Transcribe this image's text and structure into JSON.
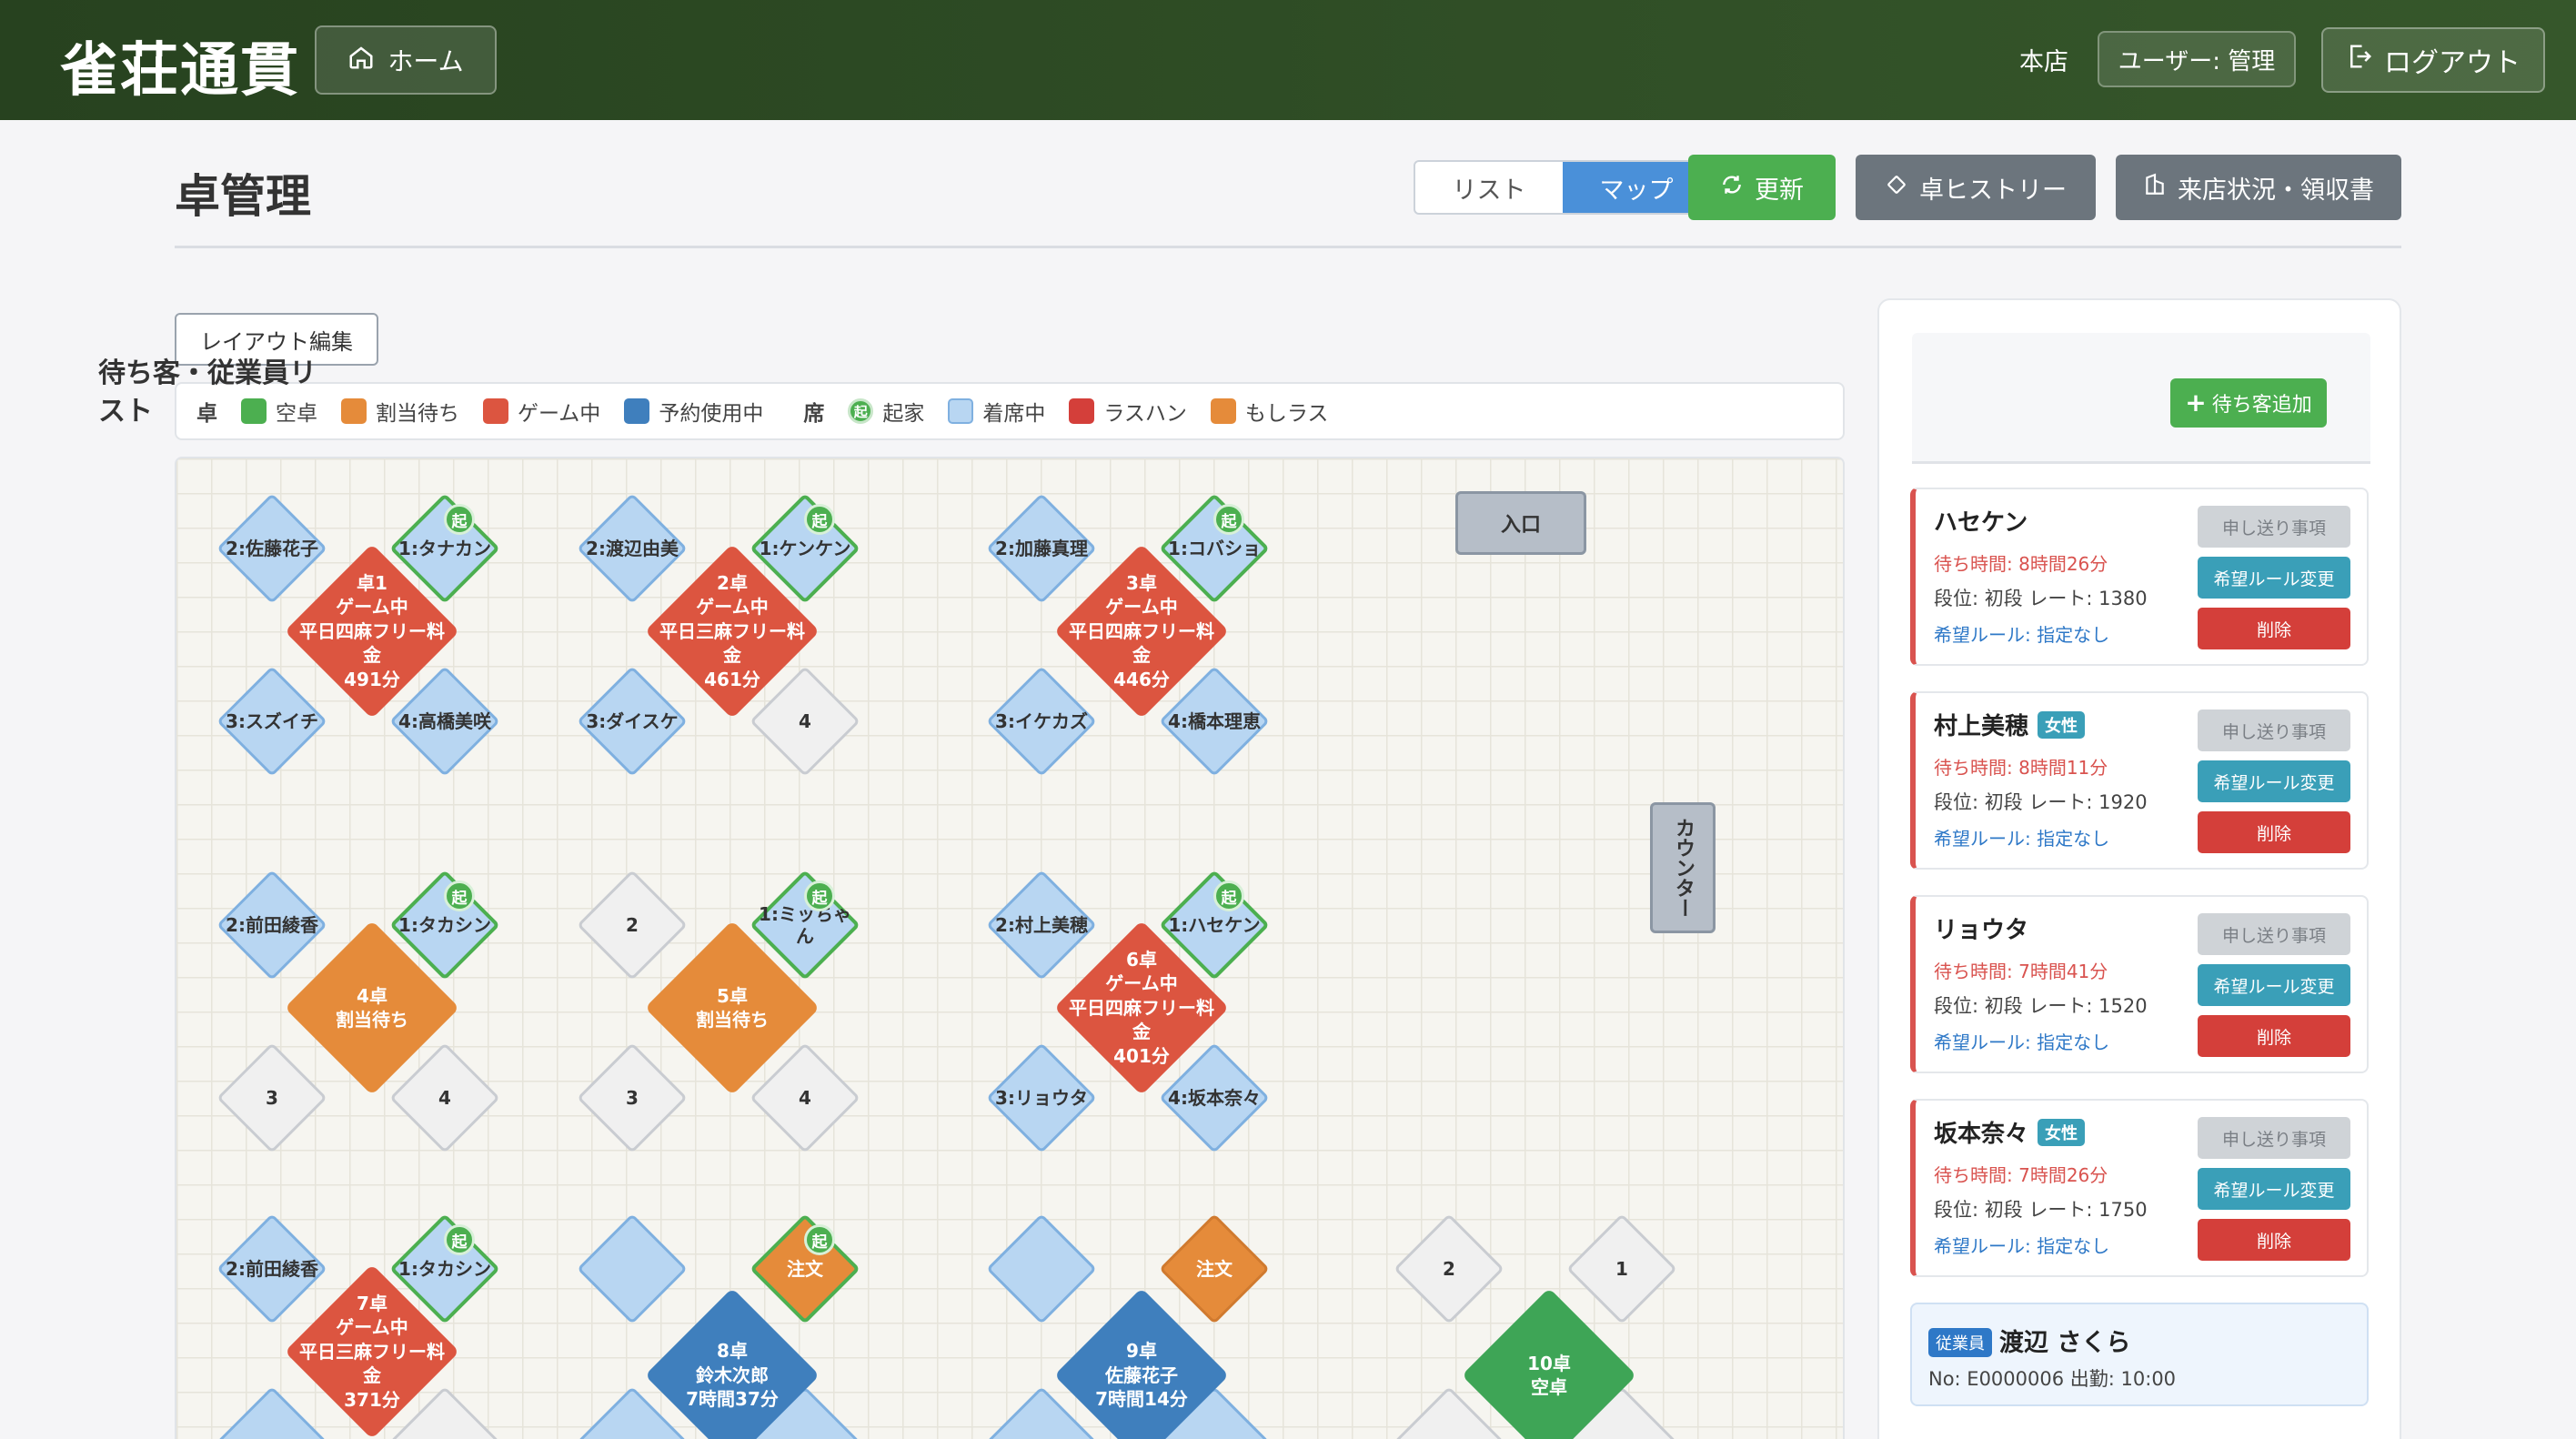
{
  "header": {
    "logo": "雀荘通貫",
    "home_label": "ホーム",
    "store": "本店",
    "user": "ユーザー: 管理",
    "logout_label": "ログアウト"
  },
  "page": {
    "title": "卓管理",
    "view_list": "リスト",
    "view_map": "マップ",
    "refresh": "更新",
    "history": "卓ヒストリー",
    "visit": "来店状況・領収書",
    "layout_edit": "レイアウト編集"
  },
  "legend": {
    "table_head": "卓",
    "seat_head": "席",
    "table_items": [
      {
        "label": "空卓",
        "color": "#4caf50"
      },
      {
        "label": "割当待ち",
        "color": "#e58b3a"
      },
      {
        "label": "ゲーム中",
        "color": "#dc5540"
      },
      {
        "label": "予約使用中",
        "color": "#3f7fbd"
      }
    ],
    "seat_items": [
      {
        "label": "起家",
        "kind": "ki",
        "mark": "起"
      },
      {
        "label": "着席中",
        "color": "#b8d6f2"
      },
      {
        "label": "ラスハン",
        "color": "#d43f3a"
      },
      {
        "label": "もしラス",
        "color": "#e58b3a"
      }
    ]
  },
  "map": {
    "entrance": "入口",
    "counter": "カウンター",
    "ki_mark": "起",
    "tables": [
      {
        "lines": [
          "卓1",
          "ゲーム中",
          "平日四麻フリー料",
          "金",
          "491分"
        ]
      },
      {
        "lines": [
          "2卓",
          "ゲーム中",
          "平日三麻フリー料",
          "金",
          "461分"
        ]
      },
      {
        "lines": [
          "3卓",
          "ゲーム中",
          "平日四麻フリー料",
          "金",
          "446分"
        ]
      },
      {
        "lines": [
          "4卓",
          "割当待ち"
        ]
      },
      {
        "lines": [
          "5卓",
          "割当待ち"
        ]
      },
      {
        "lines": [
          "6卓",
          "ゲーム中",
          "平日四麻フリー料",
          "金",
          "401分"
        ]
      },
      {
        "lines": [
          "7卓",
          "ゲーム中",
          "平日三麻フリー料",
          "金",
          "371分"
        ]
      },
      {
        "lines": [
          "8卓",
          "鈴木次郎",
          "7時間37分"
        ]
      },
      {
        "lines": [
          "9卓",
          "佐藤花子",
          "7時間14分"
        ]
      },
      {
        "lines": [
          "10卓",
          "空卓"
        ]
      }
    ],
    "seats": {
      "t1": [
        "2:佐藤花子",
        "1:タナカン",
        "3:スズイチ",
        "4:高橋美咲"
      ],
      "t2": [
        "2:渡辺由美",
        "1:ケンケン",
        "3:ダイスケ",
        "4"
      ],
      "t3": [
        "2:加藤真理",
        "1:コバショ",
        "3:イケカズ",
        "4:橋本理恵"
      ],
      "t4": [
        "2:前田綾香",
        "1:タカシン",
        "3",
        "4"
      ],
      "t5": [
        "2",
        "1:ミッちゃん",
        "3",
        "4"
      ],
      "t6": [
        "2:村上美穂",
        "1:ハセケン",
        "3:リョウタ",
        "4:坂本奈々"
      ],
      "t7": [
        "2:前田綾香",
        "1:タカシン"
      ],
      "t8": [
        "",
        "注文"
      ],
      "t9": [
        "",
        "注文"
      ],
      "t10": [
        "2",
        "1"
      ]
    }
  },
  "panel": {
    "title": "待ち客・従業員リスト",
    "add_label": "待ち客追加",
    "memo_label": "申し送り事項",
    "rule_btn_label": "希望ルール変更",
    "delete_label": "削除",
    "customers": [
      {
        "name": "ハセケン",
        "badge": "",
        "wait": "待ち時間: 8時間26分",
        "info": "段位: 初段  レート: 1380",
        "rule": "希望ルール: 指定なし"
      },
      {
        "name": "村上美穂",
        "badge": "女性",
        "wait": "待ち時間: 8時間11分",
        "info": "段位: 初段  レート: 1920",
        "rule": "希望ルール: 指定なし"
      },
      {
        "name": "リョウタ",
        "badge": "",
        "wait": "待ち時間: 7時間41分",
        "info": "段位: 初段  レート: 1520",
        "rule": "希望ルール: 指定なし"
      },
      {
        "name": "坂本奈々",
        "badge": "女性",
        "wait": "待ち時間: 7時間26分",
        "info": "段位: 初段  レート: 1750",
        "rule": "希望ルール: 指定なし"
      }
    ],
    "staff": {
      "badge": "従業員",
      "name": "渡辺 さくら",
      "info": "No: E0000006 出勤: 10:00"
    }
  }
}
